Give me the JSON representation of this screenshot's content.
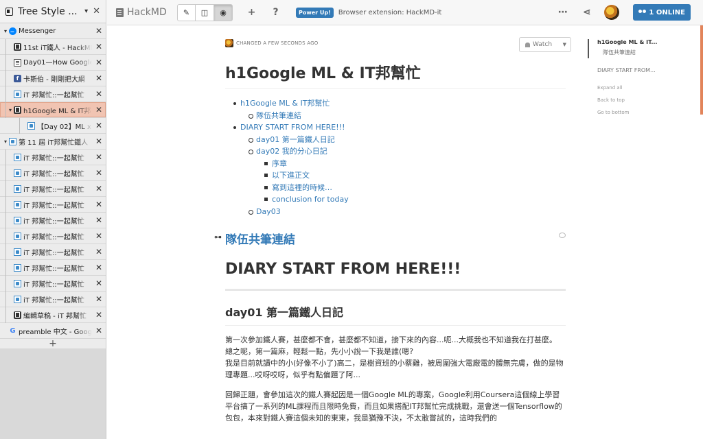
{
  "sidebar": {
    "title": "Tree Style ...",
    "new_tab": "+",
    "tabs": [
      {
        "label": "Messenger",
        "level": 0,
        "favicon": "messenger-icon",
        "twisty": "▾"
      },
      {
        "label": "11st iT鐵人 - HackMD",
        "level": 1,
        "favicon": "hackmd-icon"
      },
      {
        "label": "Day01—How Google",
        "level": 1,
        "favicon": "doc-icon"
      },
      {
        "label": "卡斯伯 - 剛剛把大綱",
        "level": 1,
        "favicon": "facebook-icon"
      },
      {
        "label": "iT 邦幫忙::一起幫忙",
        "level": 1,
        "favicon": "ithome-icon"
      },
      {
        "label": "h1Google ML & IT邦",
        "level": 1,
        "favicon": "hackmd-icon",
        "active": true,
        "twisty": "▾"
      },
      {
        "label": "【Day 02】ML x N",
        "level": 2,
        "favicon": "ithome-icon"
      },
      {
        "label": "第 11 屆 iT邦幫忙鐵人",
        "level": 0,
        "favicon": "ithome-icon",
        "twisty": "▾"
      },
      {
        "label": "iT 邦幫忙::一起幫忙",
        "level": 1,
        "favicon": "ithome-icon"
      },
      {
        "label": "iT 邦幫忙::一起幫忙",
        "level": 1,
        "favicon": "ithome-icon"
      },
      {
        "label": "iT 邦幫忙::一起幫忙",
        "level": 1,
        "favicon": "ithome-icon"
      },
      {
        "label": "iT 邦幫忙::一起幫忙",
        "level": 1,
        "favicon": "ithome-icon"
      },
      {
        "label": "iT 邦幫忙::一起幫忙",
        "level": 1,
        "favicon": "ithome-icon"
      },
      {
        "label": "iT 邦幫忙::一起幫忙",
        "level": 1,
        "favicon": "ithome-icon"
      },
      {
        "label": "iT 邦幫忙::一起幫忙",
        "level": 1,
        "favicon": "ithome-icon"
      },
      {
        "label": "iT 邦幫忙::一起幫忙",
        "level": 1,
        "favicon": "ithome-icon"
      },
      {
        "label": "iT 邦幫忙::一起幫忙",
        "level": 1,
        "favicon": "ithome-icon"
      },
      {
        "label": "iT 邦幫忙::一起幫忙",
        "level": 1,
        "favicon": "ithome-icon"
      },
      {
        "label": "編輯草稿 - iT 邦幫忙",
        "level": 1,
        "favicon": "hackmd-icon"
      },
      {
        "label": "preamble 中文 - Google",
        "level": 0,
        "favicon": "google-icon"
      }
    ]
  },
  "topbar": {
    "brand": "HackMD",
    "powerup": "Power Up!",
    "extension_text": "Browser extension: HackMD-it",
    "online_label": "1 ONLINE",
    "add_icon": "+",
    "help_icon": "?"
  },
  "doc": {
    "status": "CHANGED A FEW SECONDS AGO",
    "watch_label": "Watch",
    "title": "h1Google ML & IT邦幫忙",
    "toc": [
      {
        "label": "h1Google ML & IT邦幫忙",
        "level": 1
      },
      {
        "label": "隊伍共筆連結",
        "level": 2
      },
      {
        "label": "DIARY START FROM HERE!!!",
        "level": 1
      },
      {
        "label": "day01 第一篇鐵人日記",
        "level": 2
      },
      {
        "label": "day02 我的分心日記",
        "level": 2
      },
      {
        "label": "序章",
        "level": 3
      },
      {
        "label": "以下進正文",
        "level": 3
      },
      {
        "label": "寫到這裡的時候…",
        "level": 3
      },
      {
        "label": "conclusion for today",
        "level": 3
      },
      {
        "label": "Day03",
        "level": 2
      }
    ],
    "team_heading": "隊伍共筆連結",
    "diary_heading": "DIARY START FROM HERE!!!",
    "day01_heading": "day01 第一篇鐵人日記",
    "para1": "第一次參加鐵人賽，甚麼都不會，甚麼都不知道，接下來的內容...呃...大概我也不知道我在打甚麼。\n總之呢，第一篇麻，輕鬆一點，先小小說一下我是誰(嗯?\n我是目前就讀中的小(好像不小了)高二，是樹資班的小蔡雞，被周圍強大電廠電的體無完膚，做的是物理專題...哎呀哎呀，似乎有點偏題了阿...",
    "para2": "回歸正題，會參加這次的鐵人賽起因是一個Google ML的專案，Google利用Coursera這個線上學習平台搞了一系列的ML課程而且限時免費，而且如果搭配IT邦幫忙完成挑戰，還會送一個Tensorflow的包包，本來對鐵人賽這個未知的東東，我是猶豫不決，不太敢嘗試的，這時我們的"
  },
  "right_toc": {
    "items": [
      "h1Google ML & IT...",
      "隊伍共筆連結",
      "DIARY START FROM..."
    ],
    "expand_all": "Expand all",
    "back_to_top": "Back to top",
    "go_to_bottom": "Go to bottom"
  }
}
